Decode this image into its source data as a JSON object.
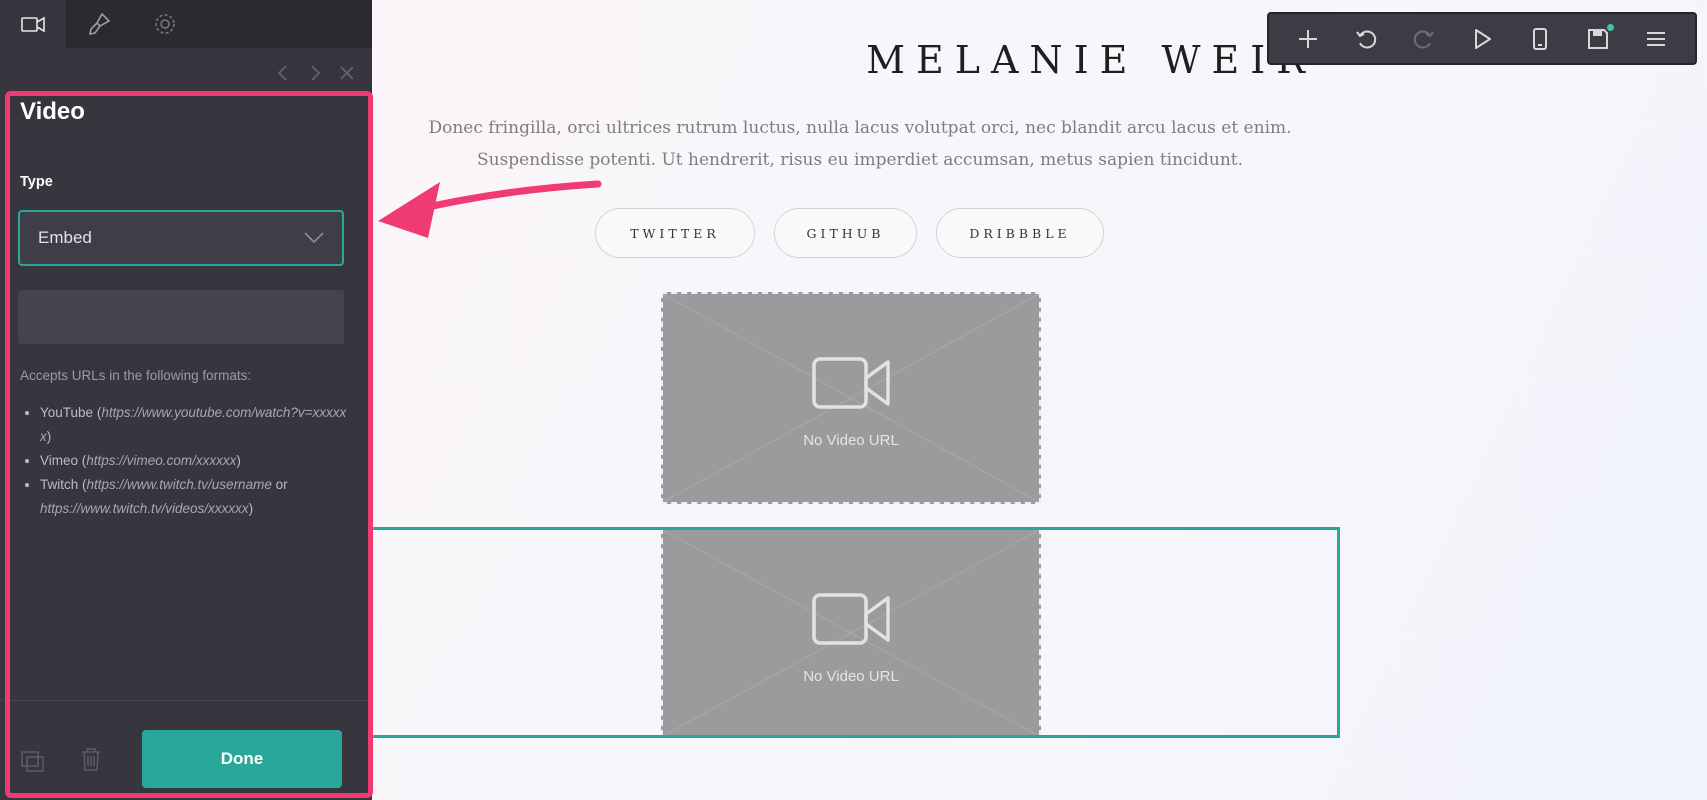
{
  "site": {
    "title": "MELANIE WEIR",
    "bio_lines": [
      "Donec fringilla, orci ultrices rutrum luctus, nulla lacus volutpat orci, nec blandit arcu lacus et enim.",
      "Suspendisse potenti. Ut hendrerit, risus eu imperdiet accumsan, metus sapien tincidunt."
    ],
    "socials": [
      {
        "label": "TWITTER"
      },
      {
        "label": "GITHUB"
      },
      {
        "label": "DRIBBBLE"
      }
    ],
    "video_placeholders": [
      {
        "label": "No Video URL"
      },
      {
        "label": "No Video URL"
      }
    ]
  },
  "toolbar": {
    "buttons": [
      "plus-icon",
      "undo-icon",
      "redo-icon",
      "play-icon",
      "mobile-icon",
      "save-icon",
      "menu-icon"
    ]
  },
  "panel": {
    "tabs": [
      "video-icon",
      "brush-icon",
      "gear-icon"
    ],
    "title": "Video",
    "type_label": "Type",
    "type_value": "Embed",
    "url_value": "",
    "help_intro": "Accepts URLs in the following formats:",
    "formats": [
      {
        "name": "YouTube",
        "urls": "https://www.youtube.com/watch?v=xxxxxx"
      },
      {
        "name": "Vimeo",
        "urls": "https://vimeo.com/xxxxxx"
      },
      {
        "name": "Twitch",
        "urls": "https://www.twitch.tv/username",
        "or": "or",
        "urls2": "https://www.twitch.tv/videos/xxxxxx"
      }
    ],
    "done_label": "Done"
  },
  "colors": {
    "accent": "#2aa79b",
    "highlight": "#f03a72",
    "panel_bg": "#37363e",
    "placeholder_bg": "#9d9a9e"
  }
}
